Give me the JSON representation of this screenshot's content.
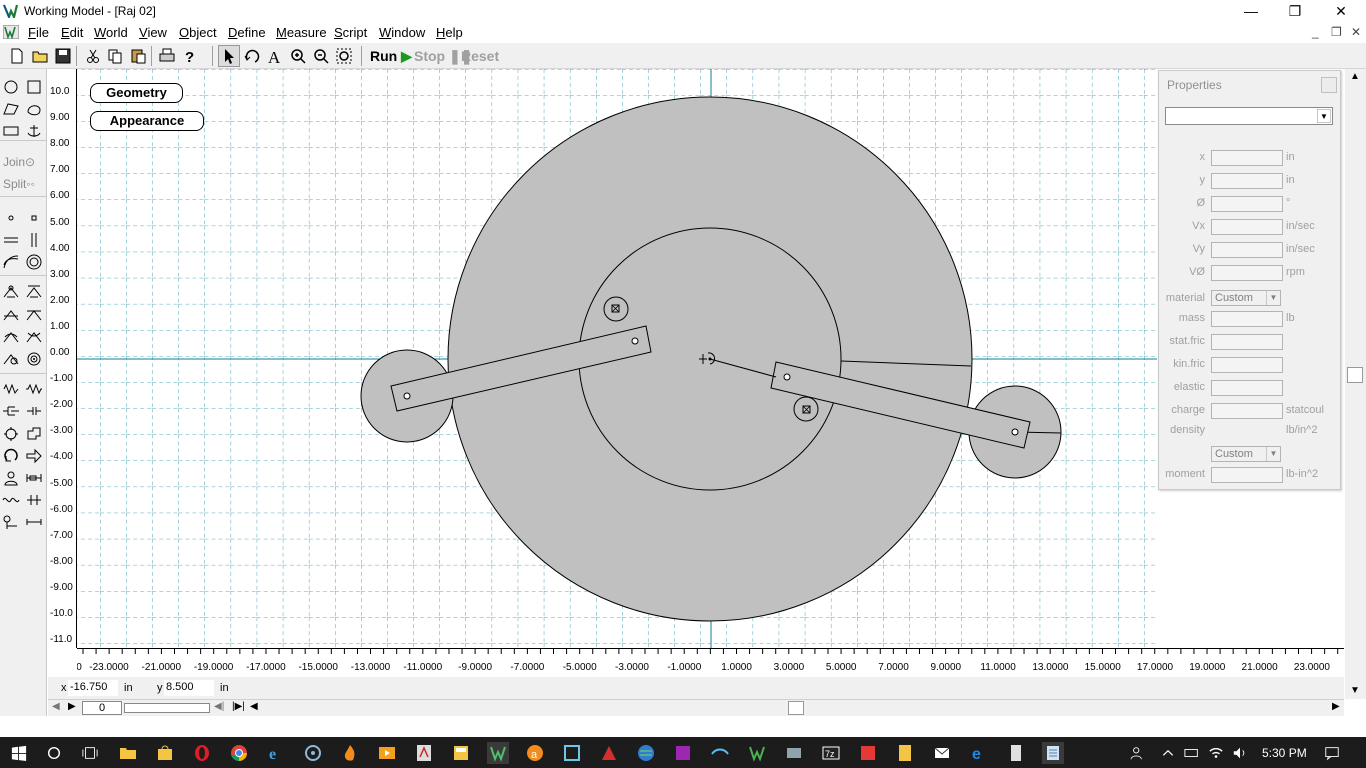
{
  "window": {
    "title": "Working Model - [Raj 02]",
    "minimize_glyph": "—",
    "restore_glyph": "❐",
    "close_glyph": "✕"
  },
  "menu": [
    "File",
    "Edit",
    "World",
    "View",
    "Object",
    "Define",
    "Measure",
    "Script",
    "Window",
    "Help"
  ],
  "mdi_controls": [
    "_",
    "❐",
    "✕"
  ],
  "toolbar": {
    "icons": [
      "new-file-icon",
      "open-folder-icon",
      "save-icon",
      "cut-icon",
      "copy-icon",
      "paste-icon",
      "print-icon",
      "help-icon",
      "arrow-select-icon",
      "rotate-icon",
      "text-icon",
      "zoom-in-icon",
      "zoom-out-icon",
      "zoom-fit-icon"
    ],
    "run_label": "Run",
    "stop_label": "Stop",
    "reset_label": "Reset"
  },
  "left_tools": {
    "join_label": "Join",
    "split_label": "Split"
  },
  "canvas_buttons": {
    "geometry_label": "Geometry",
    "appearance_label": "Appearance"
  },
  "y_ruler": [
    "10.0",
    "9.00",
    "8.00",
    "7.00",
    "6.00",
    "5.00",
    "4.00",
    "3.00",
    "2.00",
    "1.00",
    "0.00",
    "-1.00",
    "-2.00",
    "-3.00",
    "-4.00",
    "-5.00",
    "-6.00",
    "-7.00",
    "-8.00",
    "-9.00",
    "-10.0",
    "-11.0"
  ],
  "x_ruler": [
    "0",
    "-23.0000",
    "-21.0000",
    "-19.0000",
    "-17.0000",
    "-15.0000",
    "-13.0000",
    "-11.0000",
    "-9.0000",
    "-7.0000",
    "-5.0000",
    "-3.0000",
    "-1.0000",
    "1.0000",
    "3.0000",
    "5.0000",
    "7.0000",
    "9.0000",
    "11.0000",
    "13.0000",
    "15.0000",
    "17.0000",
    "19.0000",
    "21.0000",
    "23.0000"
  ],
  "coords": {
    "x_label": "x",
    "x_value": "-16.750",
    "x_unit": "in",
    "y_label": "y",
    "y_value": "8.500",
    "y_unit": "in"
  },
  "frame": {
    "value": "0"
  },
  "properties": {
    "title": "Properties",
    "selector_value": "",
    "rows": [
      {
        "label": "x",
        "unit": "in"
      },
      {
        "label": "y",
        "unit": "in"
      },
      {
        "label": "Ø",
        "unit": "°"
      },
      {
        "label": "Vx",
        "unit": "in/sec"
      },
      {
        "label": "Vy",
        "unit": "in/sec"
      },
      {
        "label": "VØ",
        "unit": "rpm"
      }
    ],
    "material_label": "material",
    "material_value": "Custom",
    "rows2": [
      {
        "label": "mass",
        "unit": "lb"
      },
      {
        "label": "stat.fric",
        "unit": ""
      },
      {
        "label": "kin.fric",
        "unit": ""
      },
      {
        "label": "elastic",
        "unit": ""
      },
      {
        "label": "charge",
        "unit": "statcoul"
      }
    ],
    "density_label": "density",
    "density_unit": "lb/in^2",
    "density_value": "Custom",
    "moment_label": "moment",
    "moment_unit": "lb-in^2"
  },
  "taskbar": {
    "time": "5:30 PM",
    "icons": [
      "windows-start-icon",
      "search-icon",
      "task-view-icon",
      "file-explorer-icon",
      "store-icon",
      "opera-icon",
      "chrome-icon",
      "internet-explorer-icon",
      "media-icon",
      "flame-app-icon",
      "video-icon",
      "adobe-icon",
      "calculator-app-icon",
      "working-model-icon",
      "avast-icon",
      "app-icon-2",
      "autocad-icon",
      "globe-app-icon",
      "app-icon-3",
      "app-icon-4",
      "app-icon-5",
      "app-icon-6",
      "7zip-icon",
      "app-icon-7",
      "calculator-icon",
      "mail-icon",
      "edge-icon",
      "calc2-icon",
      "notepad-icon"
    ]
  }
}
